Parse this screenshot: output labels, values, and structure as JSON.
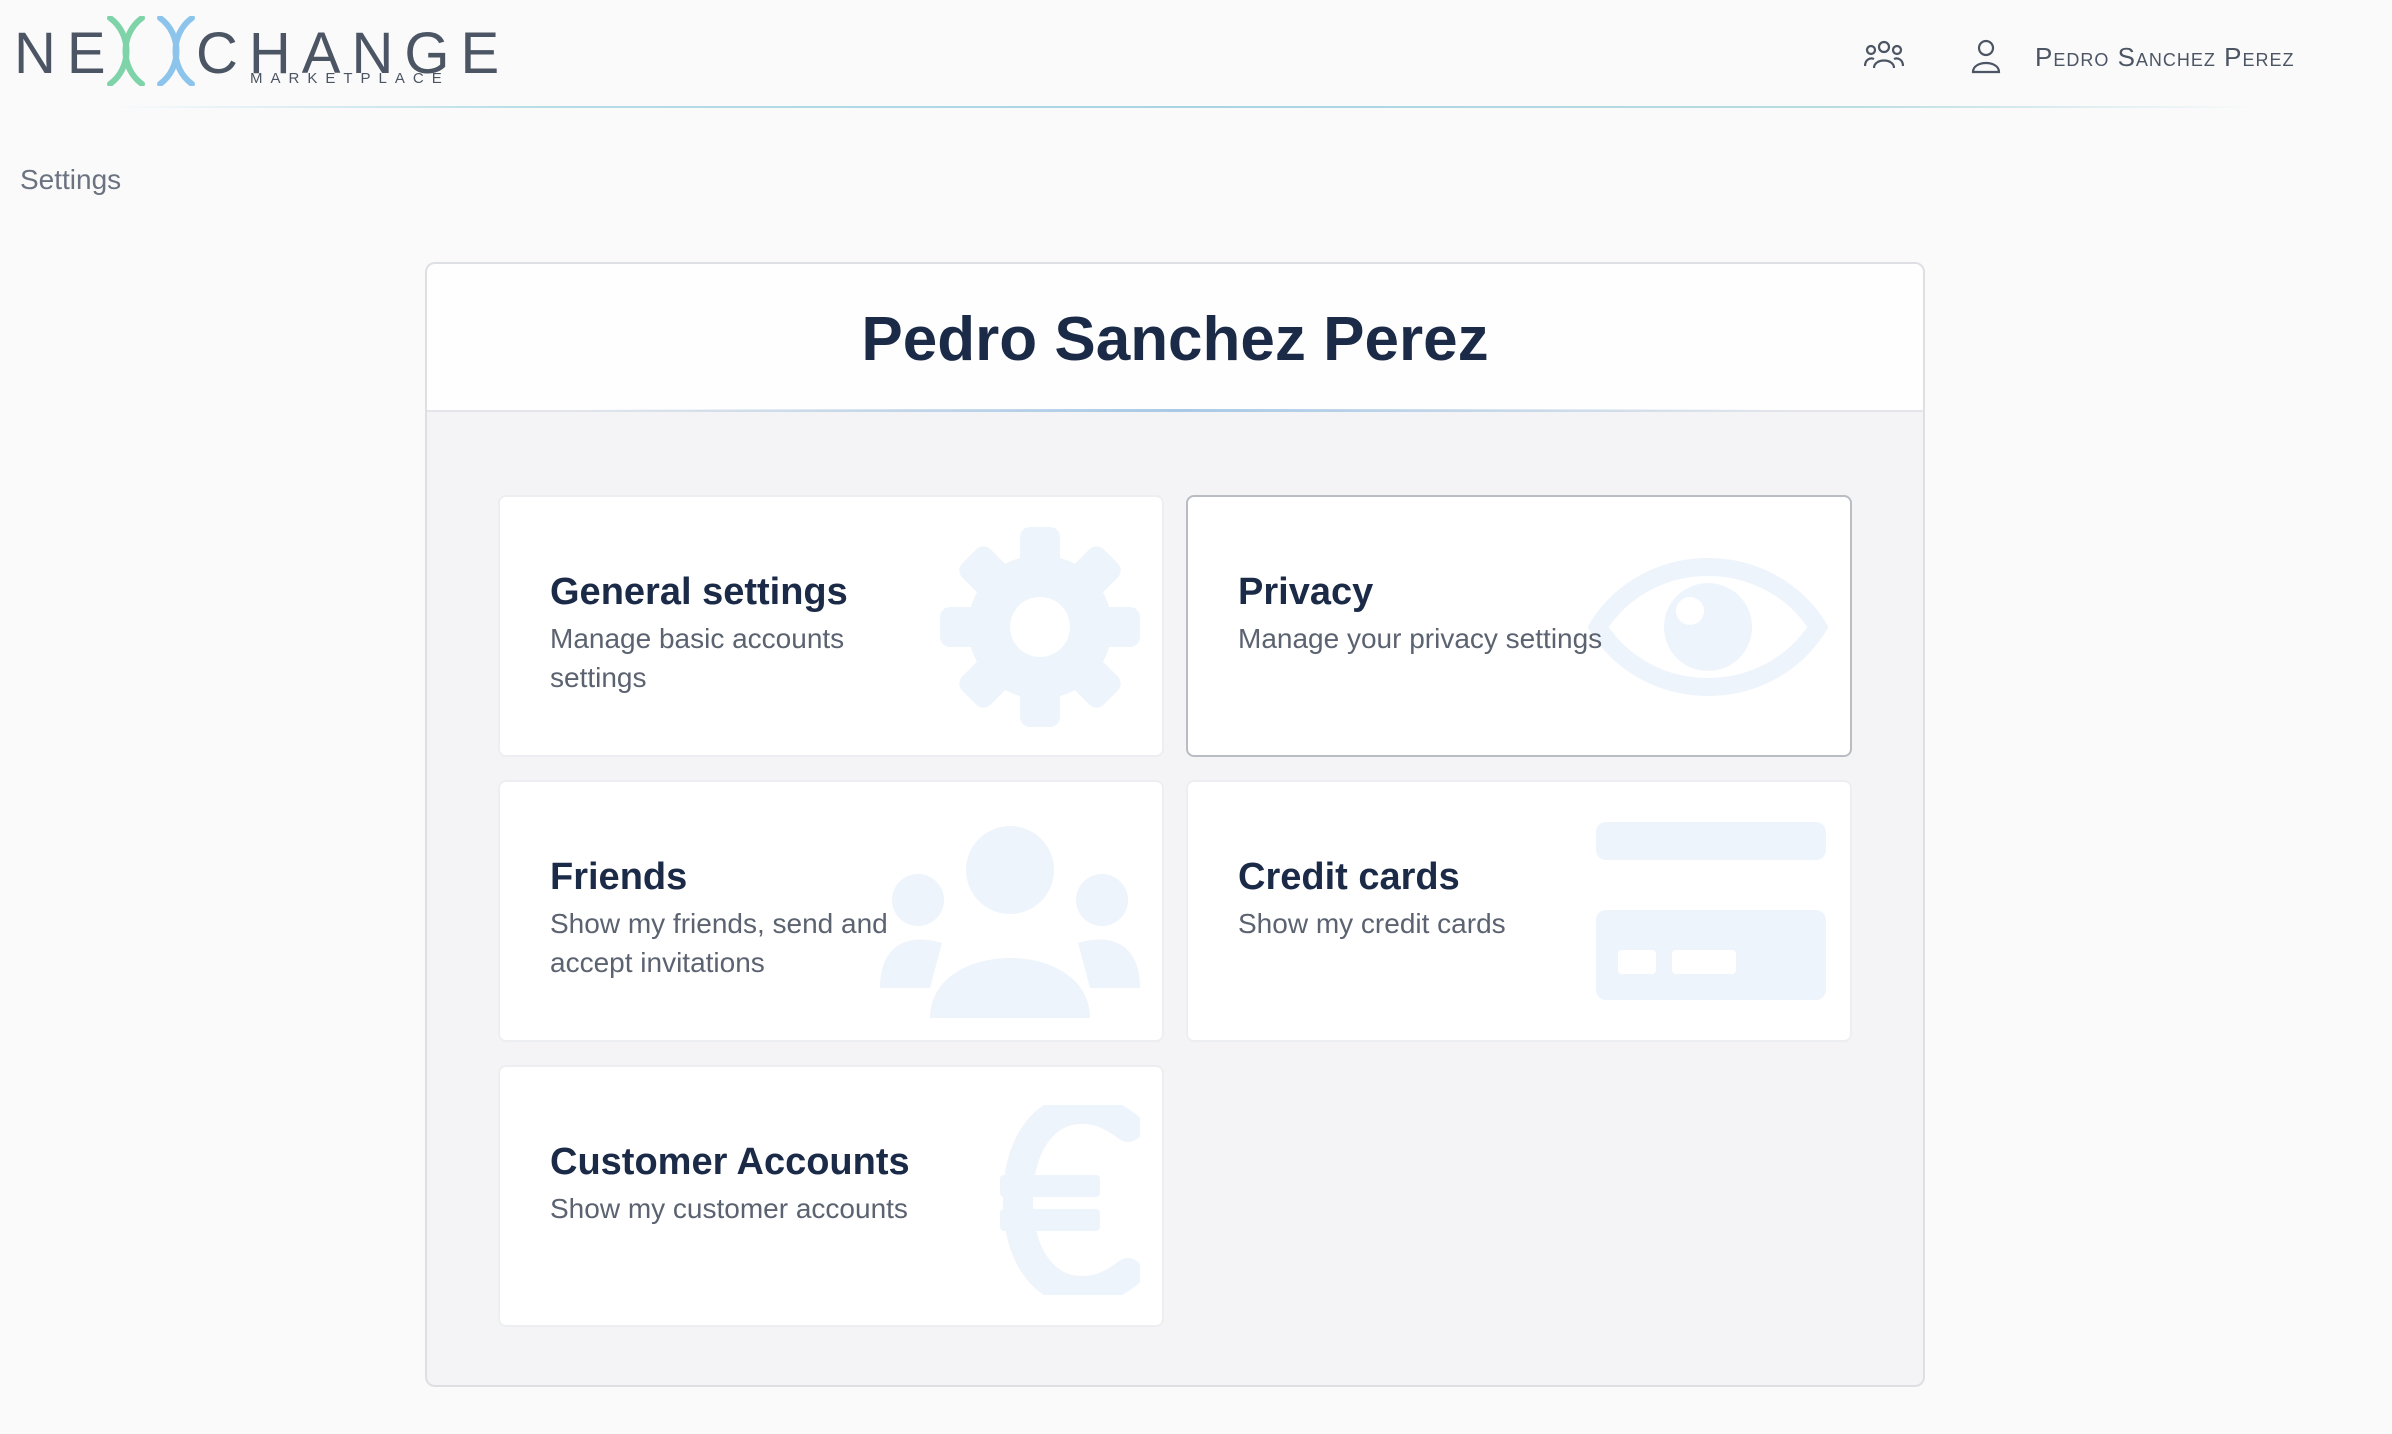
{
  "header": {
    "logo_left": "NE",
    "logo_right": "CHANGE",
    "logo_sub": "MARKETPLACE",
    "user_name": "Pedro Sanchez Perez",
    "icons": [
      "friends-icon",
      "user-icon"
    ]
  },
  "breadcrumb": "Settings",
  "panel": {
    "title": "Pedro Sanchez Perez"
  },
  "cards": [
    {
      "title": "General settings",
      "desc": "Manage basic accounts settings",
      "icon": "gear-icon"
    },
    {
      "title": "Privacy",
      "desc": "Manage your privacy settings",
      "icon": "eye-icon"
    },
    {
      "title": "Friends",
      "desc": "Show my friends, send and accept invitations",
      "icon": "friends-icon"
    },
    {
      "title": "Credit cards",
      "desc": "Show my credit cards",
      "icon": "credit-card-icon"
    },
    {
      "title": "Customer Accounts",
      "desc": "Show my customer accounts",
      "icon": "euro-icon"
    }
  ],
  "colors": {
    "text": "#1b2a47",
    "muted": "#5b6270",
    "icon_faint": "#eef4fb",
    "logo_green": "#7fd3a8",
    "logo_blue": "#8cc4ec"
  }
}
